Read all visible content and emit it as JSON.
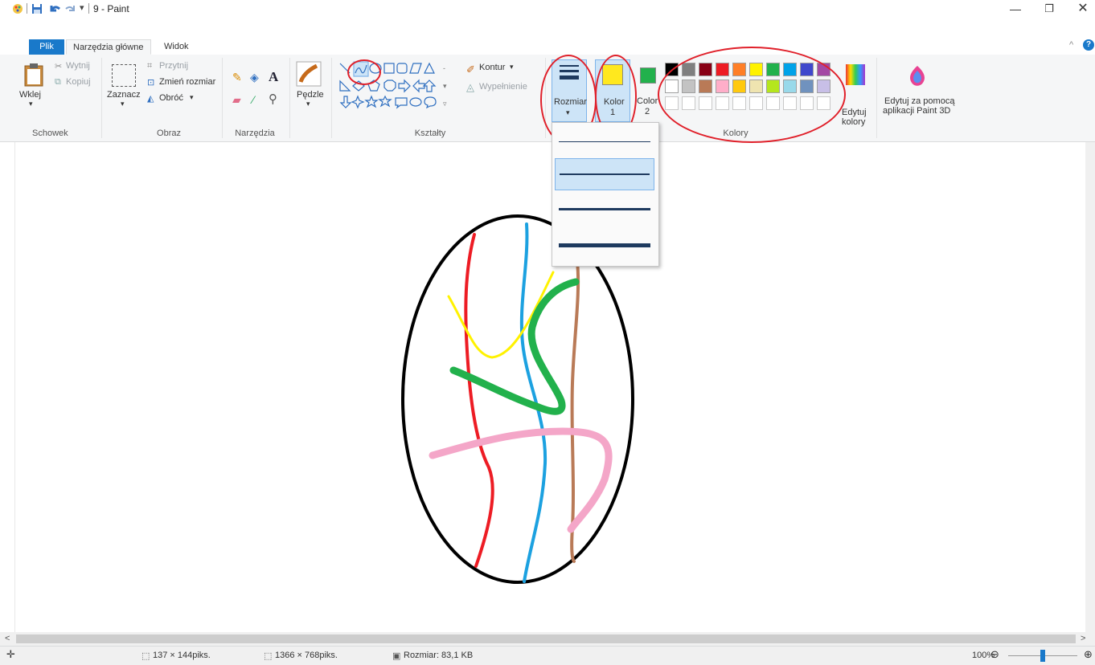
{
  "window": {
    "title": "9 - Paint"
  },
  "tabs": {
    "file": "Plik",
    "home": "Narzędzia główne",
    "view": "Widok"
  },
  "clipboard": {
    "paste": "Wklej",
    "cut": "Wytnij",
    "copy": "Kopiuj",
    "group": "Schowek"
  },
  "image": {
    "select": "Zaznacz",
    "crop": "Przytnij",
    "resize": "Zmień rozmiar",
    "rotate": "Obróć",
    "group": "Obraz"
  },
  "tools": {
    "group": "Narzędzia"
  },
  "brushes": {
    "label": "Pędzle"
  },
  "shapes": {
    "outline": "Kontur",
    "fill": "Wypełnienie",
    "group": "Kształty"
  },
  "size": {
    "label": "Rozmiar",
    "selected_index": 1
  },
  "color1": {
    "label_line1": "Kolor",
    "label_line2": "1",
    "value": "#ffe81e"
  },
  "color2": {
    "label_line1": "Color",
    "label_line2": "2",
    "value": "#22b14c"
  },
  "colors": {
    "group": "Kolory",
    "edit_line1": "Edytuj",
    "edit_line2": "kolory",
    "row1": [
      "#000000",
      "#7f7f7f",
      "#880015",
      "#ed1c24",
      "#ff7f27",
      "#fff200",
      "#22b14c",
      "#00a2e8",
      "#3f48cc",
      "#a349a4"
    ],
    "row2": [
      "#ffffff",
      "#c3c3c3",
      "#b97a57",
      "#ffaec9",
      "#ffc90e",
      "#efe4b0",
      "#b5e61d",
      "#99d9ea",
      "#7092be",
      "#c8bfe7"
    ]
  },
  "paint3d": {
    "line1": "Edytuj za pomocą",
    "line2": "aplikacji Paint 3D"
  },
  "status": {
    "selection": "137 × 144piks.",
    "canvas": "1366 × 768piks.",
    "filesize": "Rozmiar: 83,1 KB",
    "zoom": "100%"
  },
  "icons": [
    "paint-app-icon",
    "save-icon",
    "undo-icon",
    "redo-icon",
    "paste-icon",
    "cut-icon",
    "copy-icon",
    "select-icon",
    "crop-icon",
    "resize-icon",
    "rotate-icon",
    "pencil-icon",
    "fill-bucket-icon",
    "text-icon",
    "eraser-icon",
    "color-picker-icon",
    "magnifier-icon",
    "brush-icon",
    "paint3d-icon",
    "minimize-icon",
    "restore-icon",
    "close-icon",
    "help-icon",
    "collapse-ribbon-icon",
    "crosshair-icon"
  ]
}
